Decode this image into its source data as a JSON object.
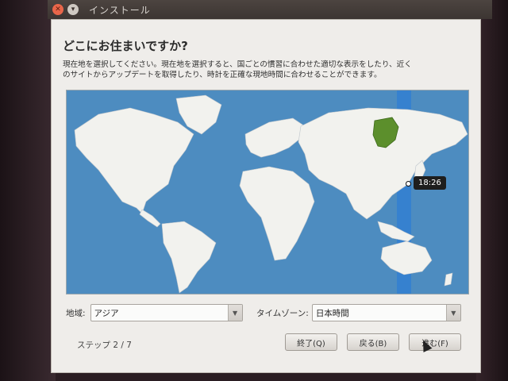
{
  "window": {
    "title": "インストール",
    "close_icon": "close-icon",
    "minimize_icon": "minimize-icon"
  },
  "page": {
    "title": "どこにお住まいですか?",
    "description_line1": "現在地を選択してください。現在地を選択すると、国ごとの慣習に合わせた適切な表示をしたり、近く",
    "description_line2": "のサイトからアップデートを取得したり、時計を正確な現地時間に合わせることができます。"
  },
  "map": {
    "selected_time": "18:26",
    "colors": {
      "ocean": "#4d8cc0",
      "land": "#f2f2ee",
      "selected_country": "#5c8f2c",
      "timezone_band": "#2f7ed4"
    }
  },
  "region": {
    "label": "地域:",
    "value": "アジア"
  },
  "timezone": {
    "label": "タイムゾーン:",
    "value": "日本時間"
  },
  "footer": {
    "step": "ステップ 2 / 7",
    "quit_label": "終了(Q)",
    "back_label": "戻る(B)",
    "forward_label": "進む(F)"
  }
}
